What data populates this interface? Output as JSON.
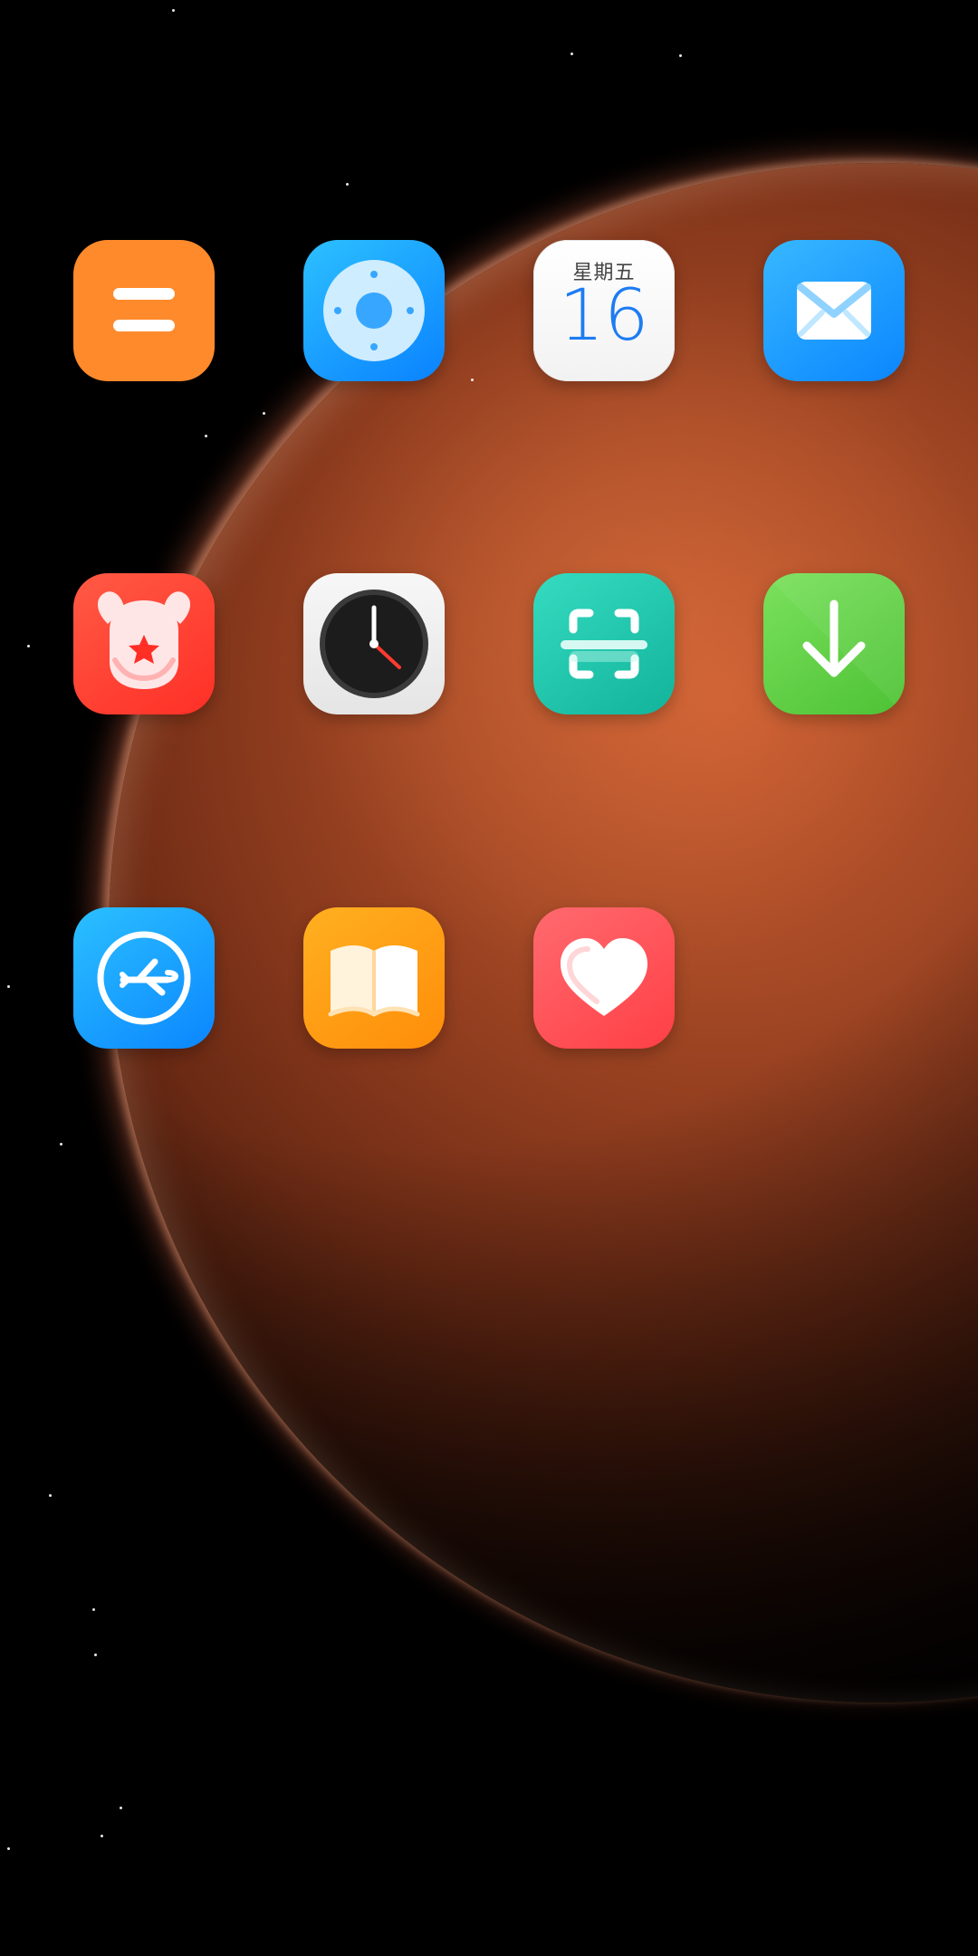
{
  "wallpaper": {
    "name": "mars"
  },
  "home_screen": {
    "apps": [
      {
        "icon": "calculator-icon",
        "color": "#ff8a2c"
      },
      {
        "icon": "remote-control-icon",
        "color": "#1ea2ff"
      },
      {
        "icon": "calendar-icon",
        "color": "#ffffff",
        "weekday": "星期五",
        "day": "16"
      },
      {
        "icon": "mail-icon",
        "color": "#27a6ff"
      },
      {
        "icon": "mi-community-icon",
        "color": "#ff3b2f"
      },
      {
        "icon": "clock-icon",
        "color": "#f2f2f2"
      },
      {
        "icon": "scanner-icon",
        "color": "#21c5a8"
      },
      {
        "icon": "download-icon",
        "color": "#66d146"
      },
      {
        "icon": "travel-flight-icon",
        "color": "#1da2ff"
      },
      {
        "icon": "reader-book-icon",
        "color": "#ff9f1a"
      },
      {
        "icon": "health-heart-icon",
        "color": "#ff4d55"
      }
    ]
  }
}
